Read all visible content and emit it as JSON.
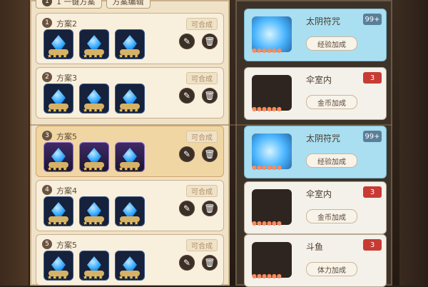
{
  "top": {
    "left_button": "1 一键方案",
    "right_button": "方案编辑"
  },
  "schemes": [
    {
      "index": "1",
      "name": "方案2",
      "compose": "可合成"
    },
    {
      "index": "2",
      "name": "方案3",
      "compose": "可合成"
    },
    {
      "index": "3",
      "name": "方案5",
      "compose": "可合成"
    },
    {
      "index": "4",
      "name": "方案4",
      "compose": "可合成"
    },
    {
      "index": "5",
      "name": "方案5",
      "compose": "可合成"
    }
  ],
  "right": {
    "items": [
      {
        "title": "太阴符咒",
        "count": "99+",
        "bonus": "经验加成"
      },
      {
        "title": "伞室内",
        "count": "3",
        "bonus": "金币加成"
      },
      {
        "title": "太阴符咒",
        "count": "99+",
        "bonus": "经验加成"
      },
      {
        "title": "伞室内",
        "count": "3",
        "bonus": "金币加成"
      },
      {
        "title": "斗鱼",
        "count": "3",
        "bonus": "体力加成"
      }
    ]
  },
  "icons": {
    "edit": "edit-icon",
    "delete": "trash-icon"
  }
}
